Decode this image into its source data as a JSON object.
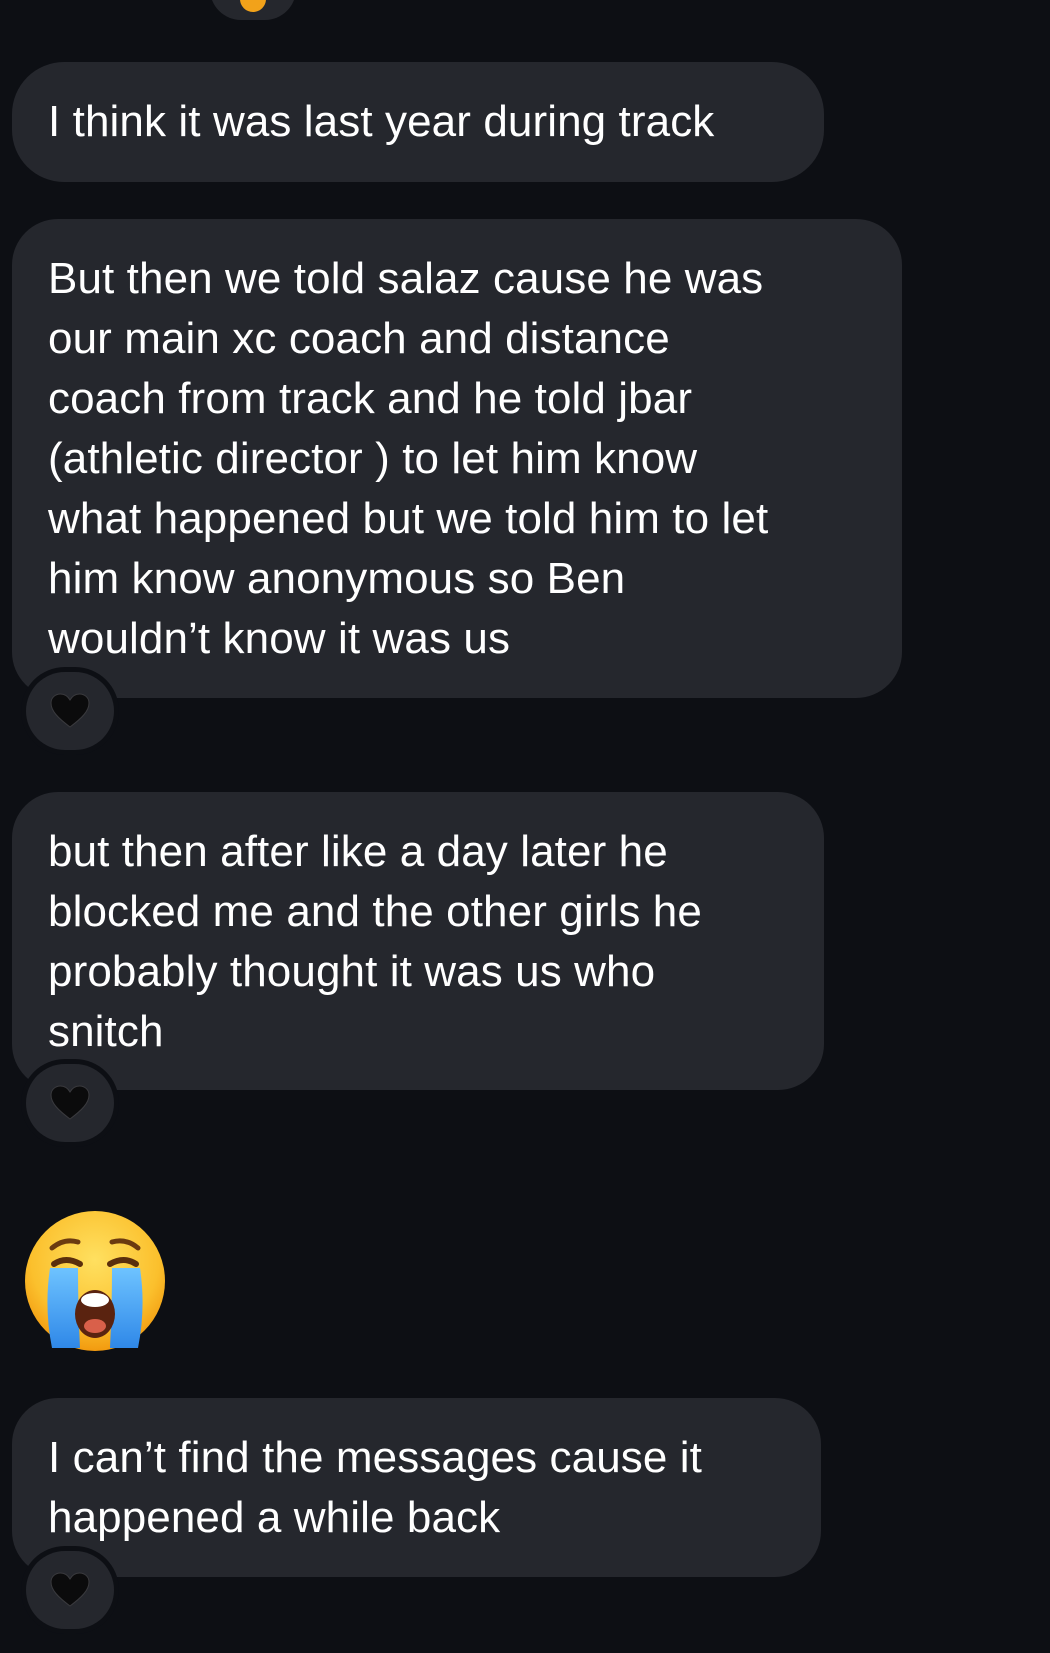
{
  "messages": [
    {
      "text": "I think it was last year during track"
    },
    {
      "text": "But then we told salaz cause he was\nour main xc coach and distance\ncoach from track and he told jbar\n(athletic director ) to let him know\nwhat happened but we told him to let\nhim know anonymous so Ben\nwouldn’t know it was us",
      "reaction": "black-heart"
    },
    {
      "text": "but then after like a day later he\nblocked me and the other girls he\nprobably thought it was us who\nsnitch",
      "reaction": "black-heart"
    },
    {
      "emoji": "loudly-crying-face"
    },
    {
      "text": "I can’t find the messages cause it\nhappened a while back",
      "reaction": "black-heart"
    }
  ],
  "colors": {
    "background": "#0d0f14",
    "bubble": "#25272d",
    "text": "#ffffff"
  }
}
